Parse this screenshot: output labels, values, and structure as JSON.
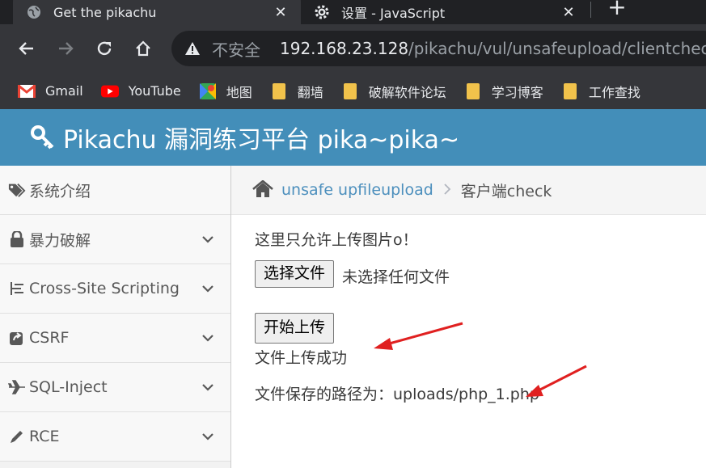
{
  "browser": {
    "tabs": [
      {
        "title": "Get the pikachu",
        "icon": "globe-icon",
        "active": true
      },
      {
        "title": "设置 - JavaScript",
        "icon": "gear-icon",
        "active": false
      }
    ],
    "new_tab": "+",
    "close": "✕",
    "address": {
      "warning": "不安全",
      "host": "192.168.23.128",
      "path": "/pikachu/vul/unsafeupload/clientcheck.php"
    },
    "bookmarks": [
      {
        "label": "Gmail",
        "icon": "gmail-icon"
      },
      {
        "label": "YouTube",
        "icon": "youtube-icon"
      },
      {
        "label": "地图",
        "icon": "maps-icon"
      },
      {
        "label": "翻墙",
        "icon": "folder-icon"
      },
      {
        "label": "破解软件论坛",
        "icon": "folder-icon"
      },
      {
        "label": "学习博客",
        "icon": "folder-icon"
      },
      {
        "label": "工作查找",
        "icon": "folder-icon"
      }
    ]
  },
  "header": {
    "title": "Pikachu 漏洞练习平台 pika~pika~",
    "icon": "key-icon"
  },
  "sidebar": {
    "items": [
      {
        "label": "系统介绍",
        "icon": "tags-icon",
        "expandable": false
      },
      {
        "label": "暴力破解",
        "icon": "lock-icon",
        "expandable": true
      },
      {
        "label": "Cross-Site Scripting",
        "icon": "list-icon",
        "expandable": true
      },
      {
        "label": "CSRF",
        "icon": "share-icon",
        "expandable": true
      },
      {
        "label": "SQL-Inject",
        "icon": "plane-icon",
        "expandable": true
      },
      {
        "label": "RCE",
        "icon": "pencil-icon",
        "expandable": true
      }
    ]
  },
  "breadcrumb": {
    "parent": "unsafe upfileupload",
    "current": "客户端check"
  },
  "main": {
    "intro": "这里只允许上传图片o！",
    "choose_file": "选择文件",
    "no_file": "未选择任何文件",
    "upload": "开始上传",
    "success": "文件上传成功",
    "path_text": "文件保存的路径为：uploads/php_1.php"
  },
  "colors": {
    "header_bg": "#438eb9",
    "link": "#4c8fbd",
    "annotation_arrow": "#e02020"
  }
}
